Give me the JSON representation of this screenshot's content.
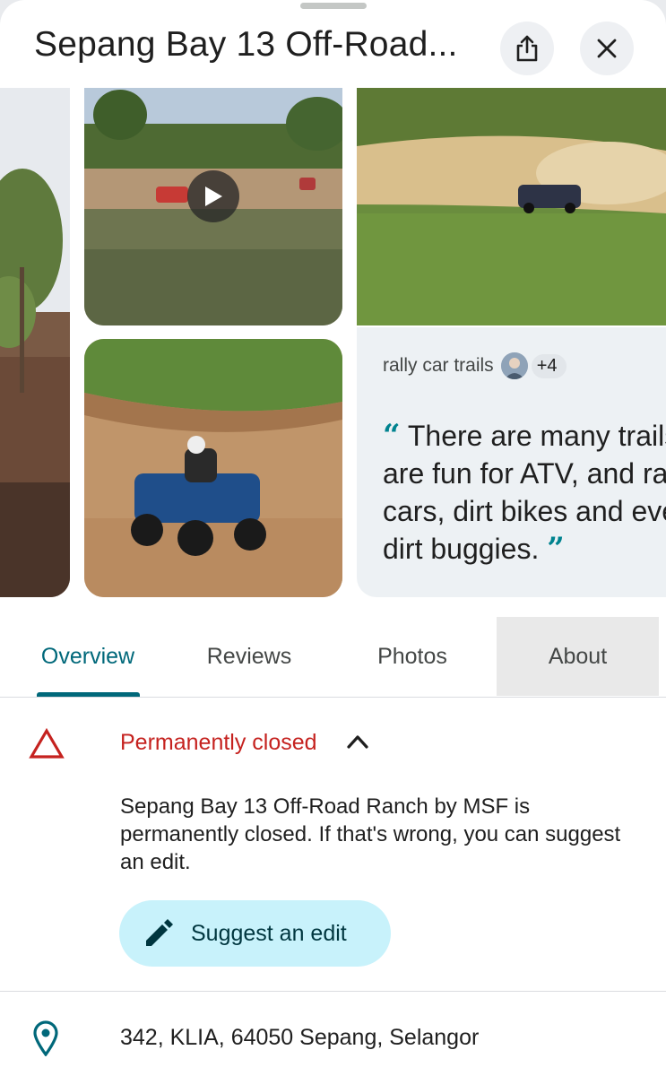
{
  "header": {
    "title": "Sepang Bay 13 Off-Road...",
    "share_icon": "share-icon",
    "close_icon": "close-icon"
  },
  "gallery": {
    "video_icon": "play-icon",
    "review": {
      "tag": "rally car trails",
      "extra_count": "+4",
      "open_quote": "“",
      "quote": "There are many trails that are fun for ATV, and rally cars, dirt bikes and even dirt buggies.",
      "close_quote": "”"
    }
  },
  "tabs": [
    {
      "label": "Overview",
      "active": true
    },
    {
      "label": "Reviews",
      "active": false
    },
    {
      "label": "Photos",
      "active": false
    },
    {
      "label": "About",
      "active": false
    }
  ],
  "status": {
    "label": "Permanently closed",
    "message": "Sepang Bay 13 Off-Road Ranch by MSF is permanently closed.  If that's wrong, you can suggest an edit.",
    "suggest_label": "Suggest an edit",
    "warning_icon": "warning-triangle-icon",
    "chevron_icon": "chevron-up-icon"
  },
  "address": {
    "text": "342, KLIA, 64050 Sepang, Selangor",
    "icon": "location-pin-icon"
  },
  "colors": {
    "accent": "#00687a",
    "closed_red": "#c5221f",
    "suggest_bg": "#c8f2fb"
  }
}
